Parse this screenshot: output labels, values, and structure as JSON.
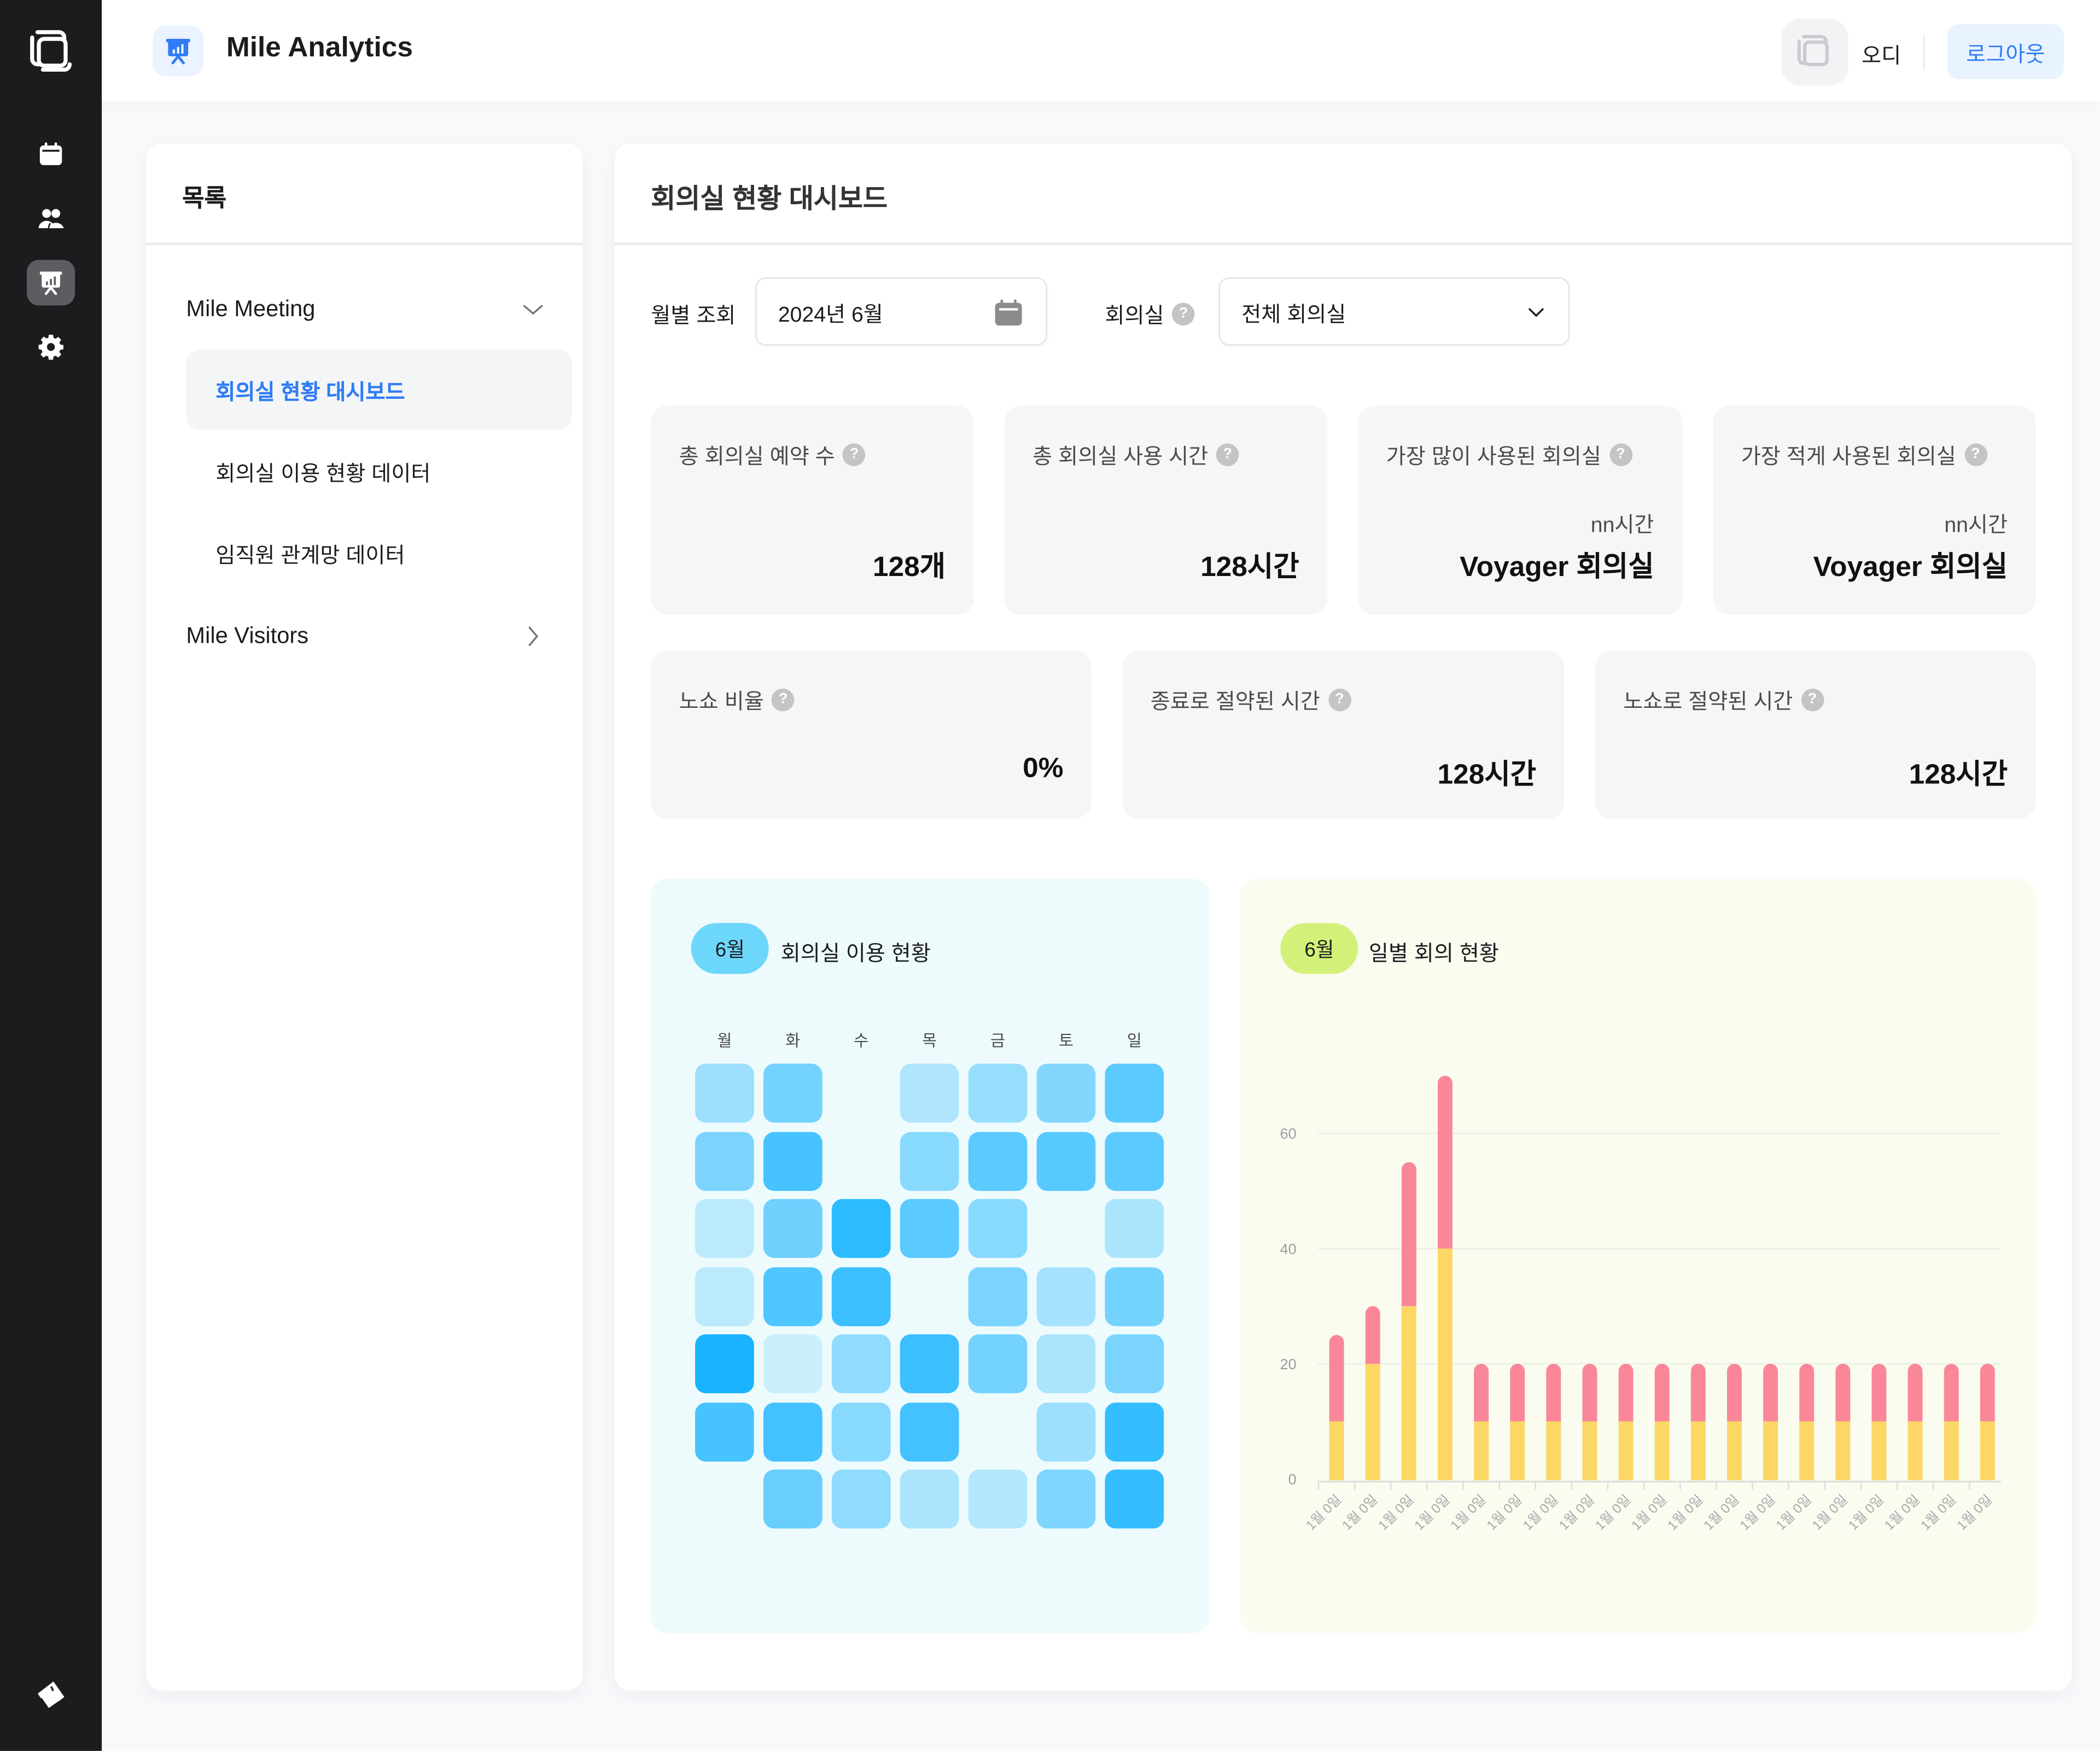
{
  "app": {
    "title": "Mile Analytics",
    "user_name": "오디",
    "logout_label": "로그아웃",
    "accent_color": "#2f7cf6"
  },
  "rail": {
    "items": [
      {
        "icon": "calendar-icon",
        "active": false
      },
      {
        "icon": "users-icon",
        "active": false
      },
      {
        "icon": "presentation-chart-icon",
        "active": true
      },
      {
        "icon": "gear-icon",
        "active": false
      }
    ],
    "bottom_icon": "eraser-icon"
  },
  "sidebar": {
    "title": "목록",
    "groups": [
      {
        "label": "Mile Meeting",
        "expanded": true,
        "items": [
          {
            "label": "회의실 현황 대시보드",
            "active": true
          },
          {
            "label": "회의실 이용 현황 데이터",
            "active": false
          },
          {
            "label": "임직원 관계망 데이터",
            "active": false
          }
        ]
      },
      {
        "label": "Mile Visitors",
        "expanded": false,
        "items": []
      }
    ]
  },
  "main": {
    "title": "회의실 현황 대시보드",
    "filters": {
      "month_label": "월별 조회",
      "month_value": "2024년 6월",
      "room_label": "회의실",
      "room_value": "전체 회의실"
    },
    "kpis_row1": [
      {
        "label": "총 회의실 예약 수",
        "value": "128개"
      },
      {
        "label": "총 회의실 사용 시간",
        "value": "128시간"
      },
      {
        "label": "가장 많이 사용된 회의실",
        "sub": "nn시간",
        "value": "Voyager 회의실"
      },
      {
        "label": "가장 적게 사용된 회의실",
        "sub": "nn시간",
        "value": "Voyager 회의실"
      }
    ],
    "kpis_row2": [
      {
        "label": "노쇼 비율",
        "value": "0%"
      },
      {
        "label": "종료로 절약된 시간",
        "value": "128시간"
      },
      {
        "label": "노쇼로 절약된 시간",
        "value": "128시간"
      }
    ],
    "help_glyph": "?"
  },
  "chart_data": [
    {
      "type": "heatmap",
      "title": "회의실 이용 현황",
      "badge": "6월",
      "badge_color": "#6dd6fb",
      "panel_color": "#eefbfd",
      "base_color": "#0fb0ff",
      "columns": [
        "월",
        "화",
        "수",
        "목",
        "금",
        "토",
        "일"
      ],
      "note": "values are relative usage intensity 0-1; null = empty cell",
      "rows": [
        [
          0.3,
          0.5,
          null,
          0.2,
          0.32,
          0.42,
          0.62
        ],
        [
          0.46,
          0.72,
          null,
          0.4,
          0.62,
          0.64,
          0.62
        ],
        [
          0.14,
          0.52,
          0.85,
          0.62,
          0.4,
          null,
          0.22
        ],
        [
          0.14,
          0.68,
          0.78,
          null,
          0.47,
          0.25,
          0.5
        ],
        [
          0.95,
          0.06,
          0.36,
          0.78,
          0.5,
          0.22,
          0.47
        ],
        [
          0.72,
          0.74,
          0.4,
          0.74,
          null,
          0.3,
          0.82
        ],
        [
          null,
          0.55,
          0.36,
          0.22,
          0.18,
          0.45,
          0.82
        ]
      ]
    },
    {
      "type": "bar",
      "stacked": true,
      "title": "일별 회의 현황",
      "badge": "6월",
      "badge_color": "#d3f178",
      "panel_color": "#f9fcef",
      "categories": [
        "1월 0일",
        "1월 0일",
        "1월 0일",
        "1월 0일",
        "1월 0일",
        "1월 0일",
        "1월 0일",
        "1월 0일",
        "1월 0일",
        "1월 0일",
        "1월 0일",
        "1월 0일",
        "1월 0일",
        "1월 0일",
        "1월 0일",
        "1월 0일",
        "1월 0일",
        "1월 0일",
        "1월 0일"
      ],
      "series": [
        {
          "name": "bottom",
          "color": "#fcd766",
          "values": [
            10,
            20,
            30,
            40,
            10,
            10,
            10,
            10,
            10,
            10,
            10,
            10,
            10,
            10,
            10,
            10,
            10,
            10,
            10
          ]
        },
        {
          "name": "top",
          "color": "#fa8798",
          "values": [
            15,
            10,
            25,
            30,
            10,
            10,
            10,
            10,
            10,
            10,
            10,
            10,
            10,
            10,
            10,
            10,
            10,
            10,
            10
          ]
        }
      ],
      "yticks": [
        0,
        20,
        40,
        60
      ],
      "ylim": [
        0,
        72
      ],
      "grid": true,
      "xlabel": "",
      "ylabel": ""
    }
  ]
}
